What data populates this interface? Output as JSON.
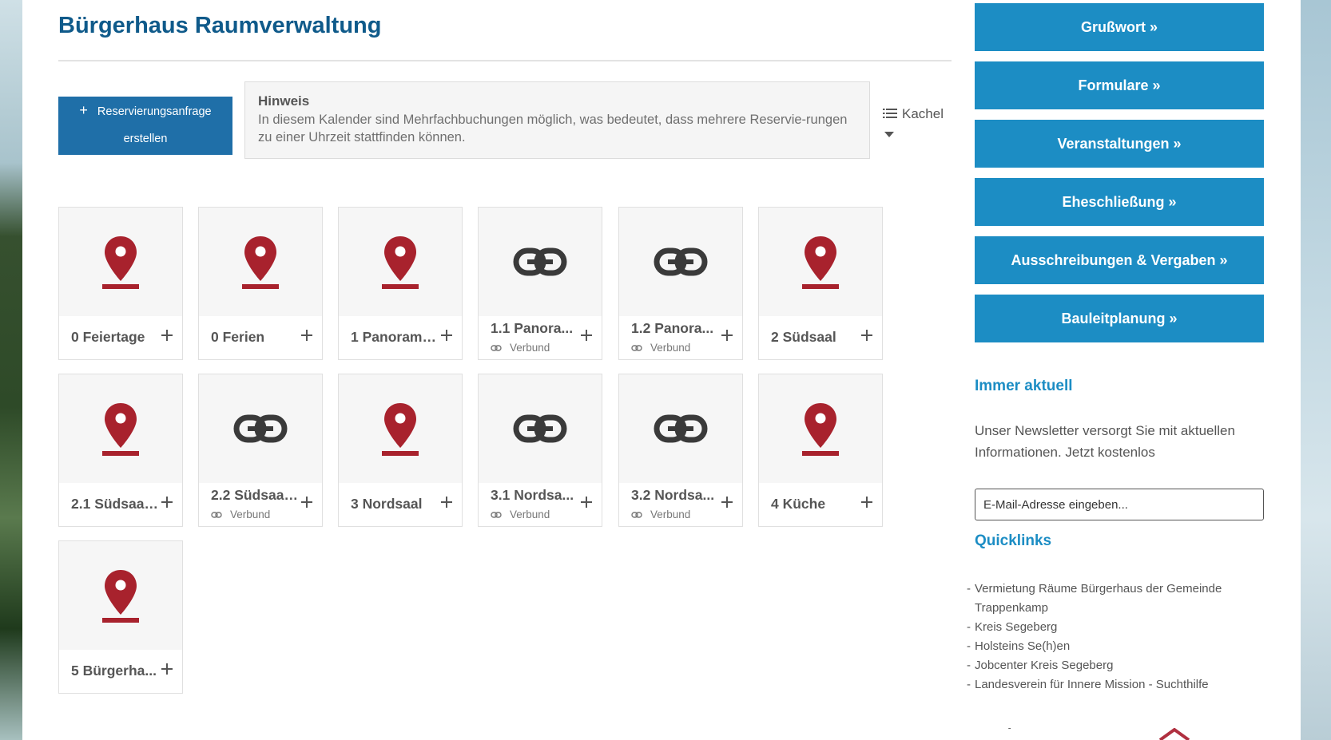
{
  "page": {
    "title": "Bürgerhaus Raumverwaltung"
  },
  "toolbar": {
    "reserve_plus": "+",
    "reserve_label": "Reservierungsanfrage erstellen",
    "view_label": "Kachel"
  },
  "hint": {
    "title": "Hinweis",
    "text": "In diesem Kalender sind Mehrfachbuchungen möglich, was bedeutet, dass mehrere Reservie-rungen zu einer Uhrzeit stattfinden können."
  },
  "rooms": [
    {
      "name": "0 Feiertage",
      "icon": "map-pin-icon",
      "sub": ""
    },
    {
      "name": "0 Ferien",
      "icon": "map-pin-icon",
      "sub": ""
    },
    {
      "name": "1 Panorama...",
      "icon": "map-pin-icon",
      "sub": ""
    },
    {
      "name": "1.1 Panora...",
      "icon": "link-icon",
      "sub": "Verbund"
    },
    {
      "name": "1.2 Panora...",
      "icon": "link-icon",
      "sub": "Verbund"
    },
    {
      "name": "2 Südsaal",
      "icon": "map-pin-icon",
      "sub": ""
    },
    {
      "name": "2.1 Südsaal...",
      "icon": "map-pin-icon",
      "sub": ""
    },
    {
      "name": "2.2 Südsaal...",
      "icon": "link-icon",
      "sub": "Verbund"
    },
    {
      "name": "3 Nordsaal",
      "icon": "map-pin-icon",
      "sub": ""
    },
    {
      "name": "3.1 Nordsa...",
      "icon": "link-icon",
      "sub": "Verbund"
    },
    {
      "name": "3.2 Nordsa...",
      "icon": "link-icon",
      "sub": "Verbund"
    },
    {
      "name": "4 Küche",
      "icon": "map-pin-icon",
      "sub": ""
    },
    {
      "name": "5 Bürgerha...",
      "icon": "map-pin-icon",
      "sub": ""
    }
  ],
  "sidebar": {
    "buttons": [
      "Grußwort »",
      "Formulare »",
      "Veranstaltungen »",
      "Eheschließung »",
      "Ausschreibungen & Vergaben »",
      "Bauleitplanung »"
    ],
    "newsletter_heading": "Immer aktuell",
    "newsletter_text": "Unser Newsletter versorgt Sie mit aktuellen Informationen. Jetzt kostenlos",
    "email_placeholder": "E-Mail-Adresse eingeben...",
    "quicklinks_heading": "Quicklinks",
    "quicklinks": [
      "Vermietung Räume Bürgerhaus der Gemeinde Trappenkamp",
      "Kreis Segeberg",
      "Holsteins Se(h)en",
      "Jobcenter Kreis Segeberg",
      "Landesverein für Innere Mission - Suchthilfe"
    ],
    "footer_dash": "-"
  },
  "colors": {
    "title": "#0f5a8a",
    "primary_button": "#1f6fa8",
    "sidebar_button": "#1c8dc4",
    "pin": "#a8222d",
    "link": "#3a3a3a"
  }
}
